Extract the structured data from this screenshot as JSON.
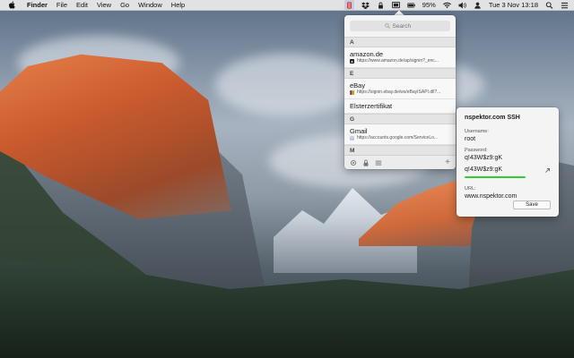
{
  "menubar": {
    "app_name": "Finder",
    "menus": [
      "File",
      "Edit",
      "View",
      "Go",
      "Window",
      "Help"
    ],
    "battery": "95%",
    "clock": "Tue 3 Nov  13:18",
    "status_icons": [
      "password-manager-icon",
      "dropbox-icon",
      "lock-icon",
      "screen-icon",
      "battery-icon",
      "wifi-icon",
      "volume-icon",
      "user-icon",
      "search-icon",
      "menu-icon"
    ]
  },
  "popover": {
    "search_placeholder": "Search",
    "sections": [
      {
        "letter": "A",
        "entries": [
          {
            "name": "amazon.de",
            "url": "https://www.amazon.de/ap/signin?_enc...",
            "favicon": "amazon"
          }
        ]
      },
      {
        "letter": "E",
        "entries": [
          {
            "name": "eBay",
            "url": "https://signin.ebay.de/ws/eBayISAPI.dll?...",
            "favicon": "ebay"
          },
          {
            "name": "Elsterzertifikat",
            "url": "",
            "favicon": ""
          }
        ]
      },
      {
        "letter": "G",
        "entries": [
          {
            "name": "Gmail",
            "url": "https://accounts.google.com/ServiceLo...",
            "favicon": "google"
          }
        ]
      },
      {
        "letter": "M",
        "entries": []
      }
    ],
    "footer_add": "+"
  },
  "detail": {
    "title": "nspektor.com SSH",
    "username_label": "Username:",
    "username": "root",
    "password_label": "Password:",
    "password": "q!43W$z9:gK",
    "password_preview": "q!43W$z9:gK",
    "url_label": "URL:",
    "url": "www.nspektor.com",
    "save_label": "Save",
    "strength_color": "#2ecc2e"
  }
}
